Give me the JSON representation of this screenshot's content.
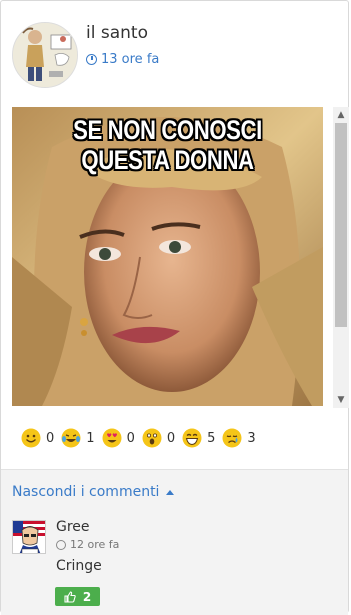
{
  "post": {
    "author": "il santo",
    "time": "13 ore fa",
    "avatar_icon": "cartoon-avatar-icon",
    "meme_lines": [
      "SE NON CONOSCI",
      "QUESTA DONNA"
    ]
  },
  "reactions": [
    {
      "icon": "smile-emoji-icon",
      "count": "0"
    },
    {
      "icon": "laugh-tears-emoji-icon",
      "count": "1"
    },
    {
      "icon": "heart-eyes-emoji-icon",
      "count": "0"
    },
    {
      "icon": "surprised-emoji-icon",
      "count": "0"
    },
    {
      "icon": "grin-emoji-icon",
      "count": "5"
    },
    {
      "icon": "crying-emoji-icon",
      "count": "3"
    }
  ],
  "comments": {
    "toggle_label": "Nascondi i commenti",
    "items": [
      {
        "author": "Gree",
        "time": "12 ore fa",
        "text": "Cringe",
        "likes": "2"
      }
    ]
  },
  "colors": {
    "accent": "#3a7bc8",
    "like": "#4cae4c",
    "emoji": "#f5c518"
  }
}
